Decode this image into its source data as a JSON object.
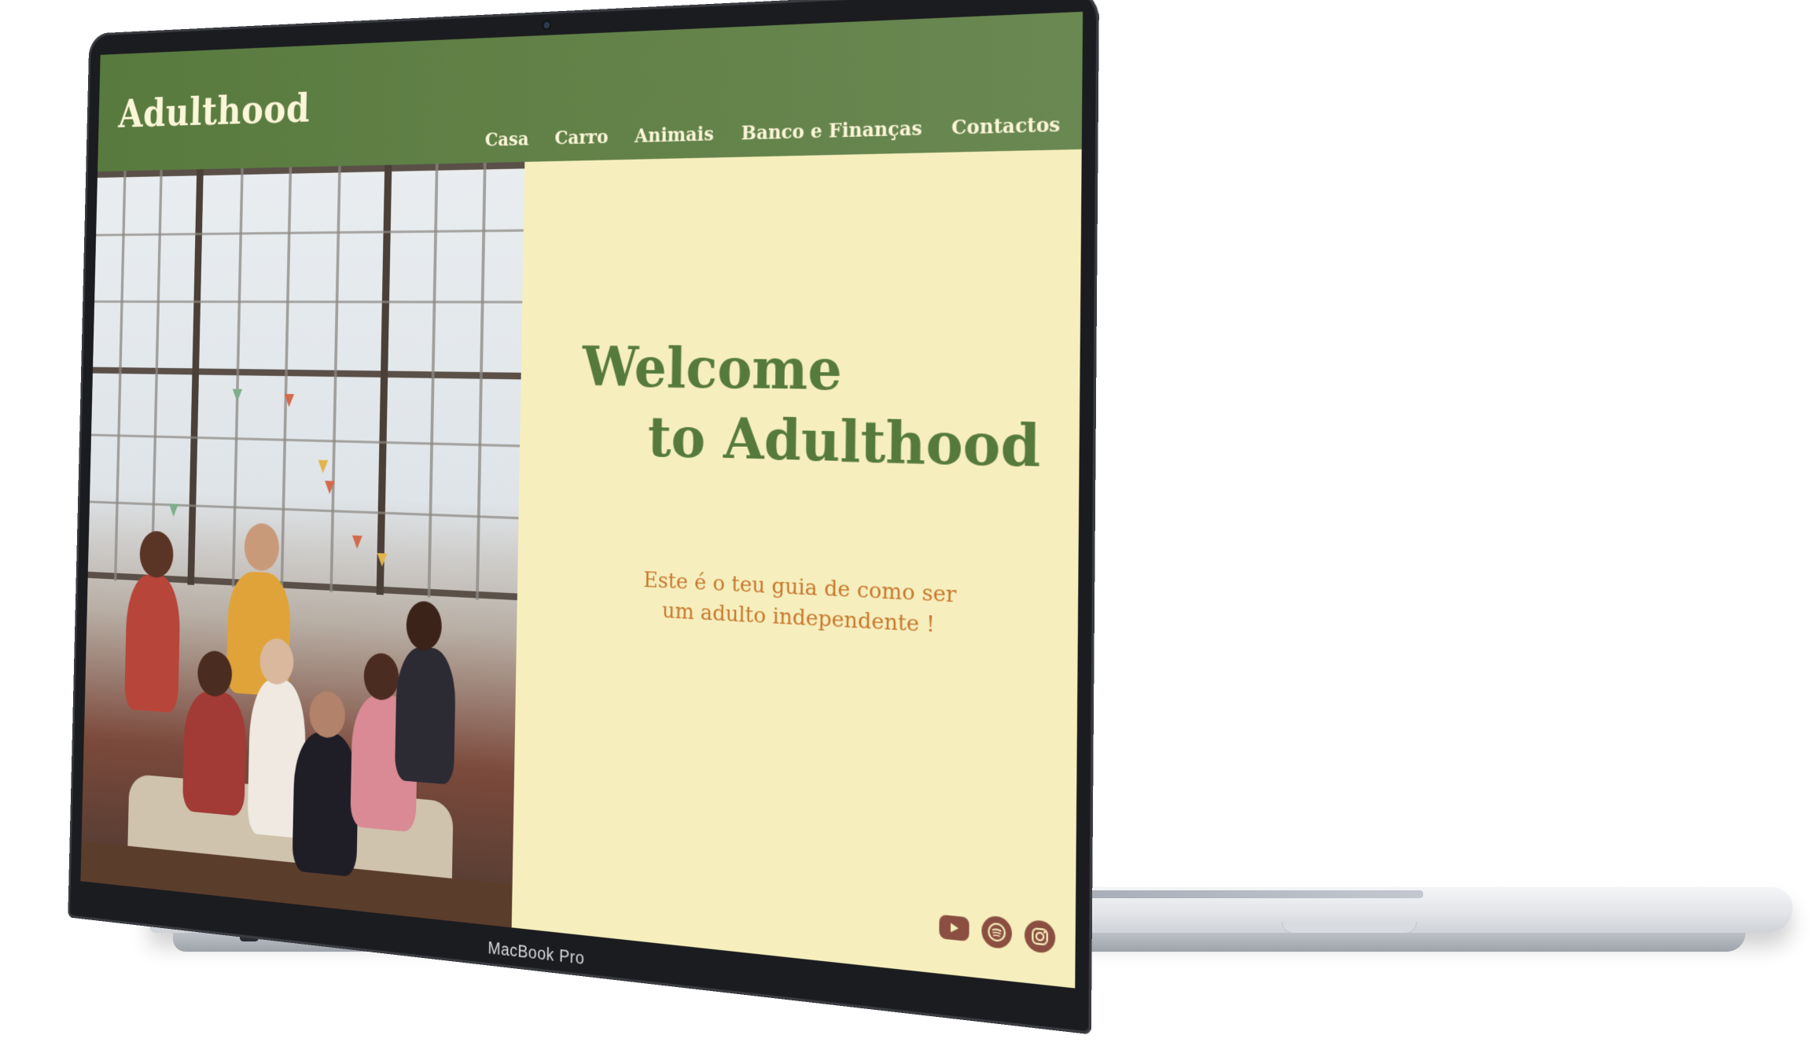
{
  "device": {
    "model_label": "MacBook Pro"
  },
  "site": {
    "brand": "Adulthood",
    "nav": [
      {
        "label": "Casa"
      },
      {
        "label": "Carro"
      },
      {
        "label": "Animais"
      },
      {
        "label": "Banco e Finanças"
      },
      {
        "label": "Contactos"
      }
    ],
    "hero": {
      "title_line1": "Welcome",
      "title_line2": "to Adulthood",
      "subtitle": "Este é o teu guia de como ser um adulto independente !"
    },
    "social": [
      {
        "icon": "youtube-icon"
      },
      {
        "icon": "spotify-icon"
      },
      {
        "icon": "instagram-icon"
      }
    ]
  },
  "colors": {
    "header_green": "#587a3e",
    "title_green": "#557a3c",
    "background_cream": "#f6efbd",
    "subtitle_orange": "#c7772e",
    "social_brown": "#8b4f42"
  }
}
